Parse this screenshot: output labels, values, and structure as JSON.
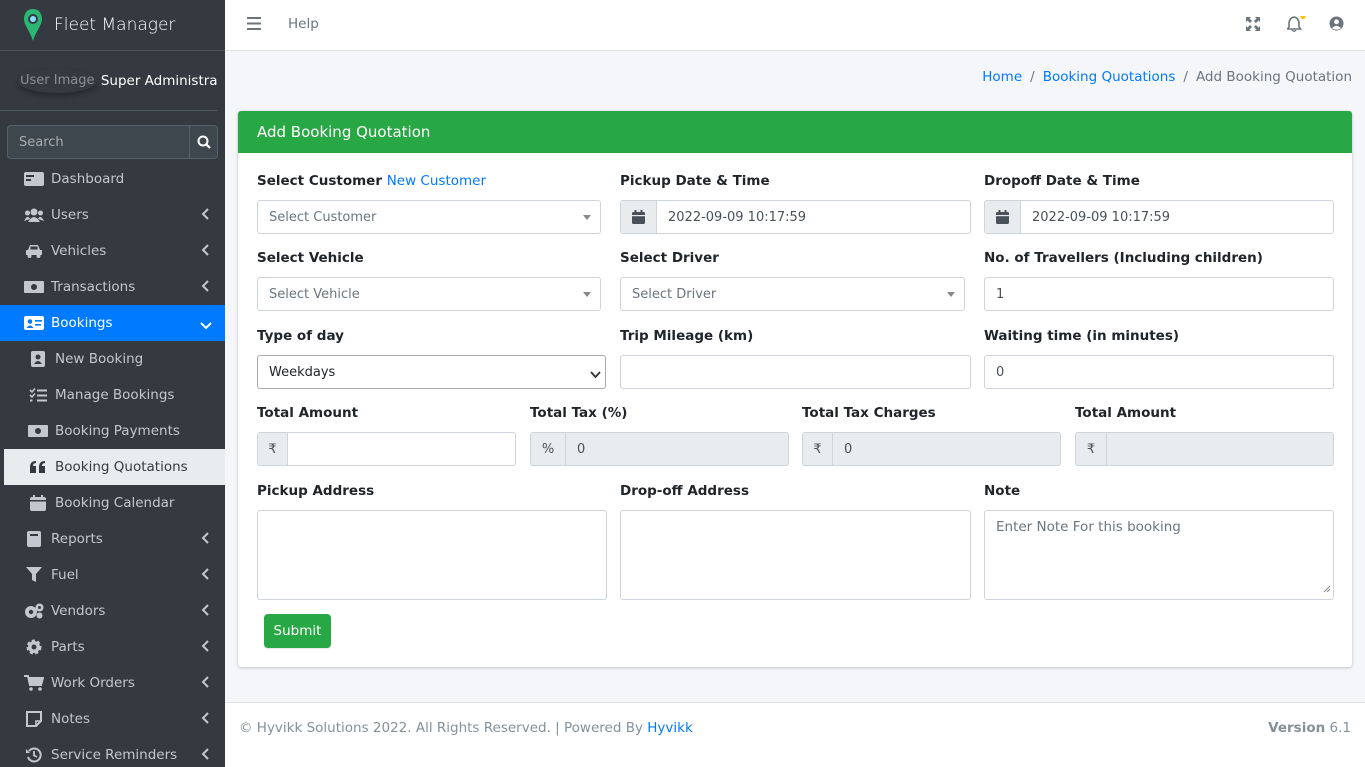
{
  "brand": {
    "title": "Fleet Manager",
    "accent": "#28a745"
  },
  "user": {
    "img_alt": "User Image",
    "name": "Super Administrator"
  },
  "sidebar": {
    "search_placeholder": "Search",
    "items": [
      {
        "label": "Dashboard",
        "icon": "dashboard-icon"
      },
      {
        "label": "Users",
        "icon": "users-icon"
      },
      {
        "label": "Vehicles",
        "icon": "car-icon"
      },
      {
        "label": "Transactions",
        "icon": "money-icon"
      },
      {
        "label": "Bookings",
        "icon": "address-card-icon"
      },
      {
        "label": "Reports",
        "icon": "book-icon"
      },
      {
        "label": "Fuel",
        "icon": "filter-icon"
      },
      {
        "label": "Vendors",
        "icon": "cogs-icon"
      },
      {
        "label": "Parts",
        "icon": "gear-icon"
      },
      {
        "label": "Work Orders",
        "icon": "cart-icon"
      },
      {
        "label": "Notes",
        "icon": "note-icon"
      },
      {
        "label": "Service Reminders",
        "icon": "history-icon"
      }
    ],
    "bookings_sub": [
      {
        "label": "New Booking",
        "icon": "address-book-icon"
      },
      {
        "label": "Manage Bookings",
        "icon": "tasks-icon"
      },
      {
        "label": "Booking Payments",
        "icon": "money-icon"
      },
      {
        "label": "Booking Quotations",
        "icon": "quote-icon"
      },
      {
        "label": "Booking Calendar",
        "icon": "calendar-icon"
      }
    ]
  },
  "topbar": {
    "help": "Help"
  },
  "breadcrumb": {
    "home": "Home",
    "parent": "Booking Quotations",
    "current": "Add Booking Quotation"
  },
  "form": {
    "title": "Add Booking Quotation",
    "customer_label": "Select Customer",
    "new_customer": "New Customer",
    "customer_placeholder": "Select Customer",
    "pickup_label": "Pickup Date & Time",
    "pickup_value": "2022-09-09 10:17:59",
    "dropoff_label": "Dropoff Date & Time",
    "dropoff_value": "2022-09-09 10:17:59",
    "vehicle_label": "Select Vehicle",
    "vehicle_placeholder": "Select Vehicle",
    "driver_label": "Select Driver",
    "driver_placeholder": "Select Driver",
    "travellers_label": "No. of Travellers (Including children)",
    "travellers_value": "1",
    "dayType_label": "Type of day",
    "dayType_value": "Weekdays",
    "mileage_label": "Trip Mileage (km)",
    "waiting_label": "Waiting time (in minutes)",
    "waiting_value": "0",
    "amount_label": "Total Amount",
    "currency": "₹",
    "tax_label": "Total Tax (%)",
    "percent": "%",
    "tax_value": "0",
    "tax_charges_label": "Total Tax Charges",
    "tax_charges_value": "0",
    "total_label": "Total Amount",
    "pickup_addr_label": "Pickup Address",
    "dropoff_addr_label": "Drop-off Address",
    "note_label": "Note",
    "note_placeholder": "Enter Note For this booking",
    "submit": "Submit"
  },
  "footer": {
    "copyright": "© Hyvikk Solutions 2022. All Rights Reserved. | Powered By ",
    "powered_link": "Hyvikk",
    "version_label": "Version",
    "version": "6.1"
  }
}
